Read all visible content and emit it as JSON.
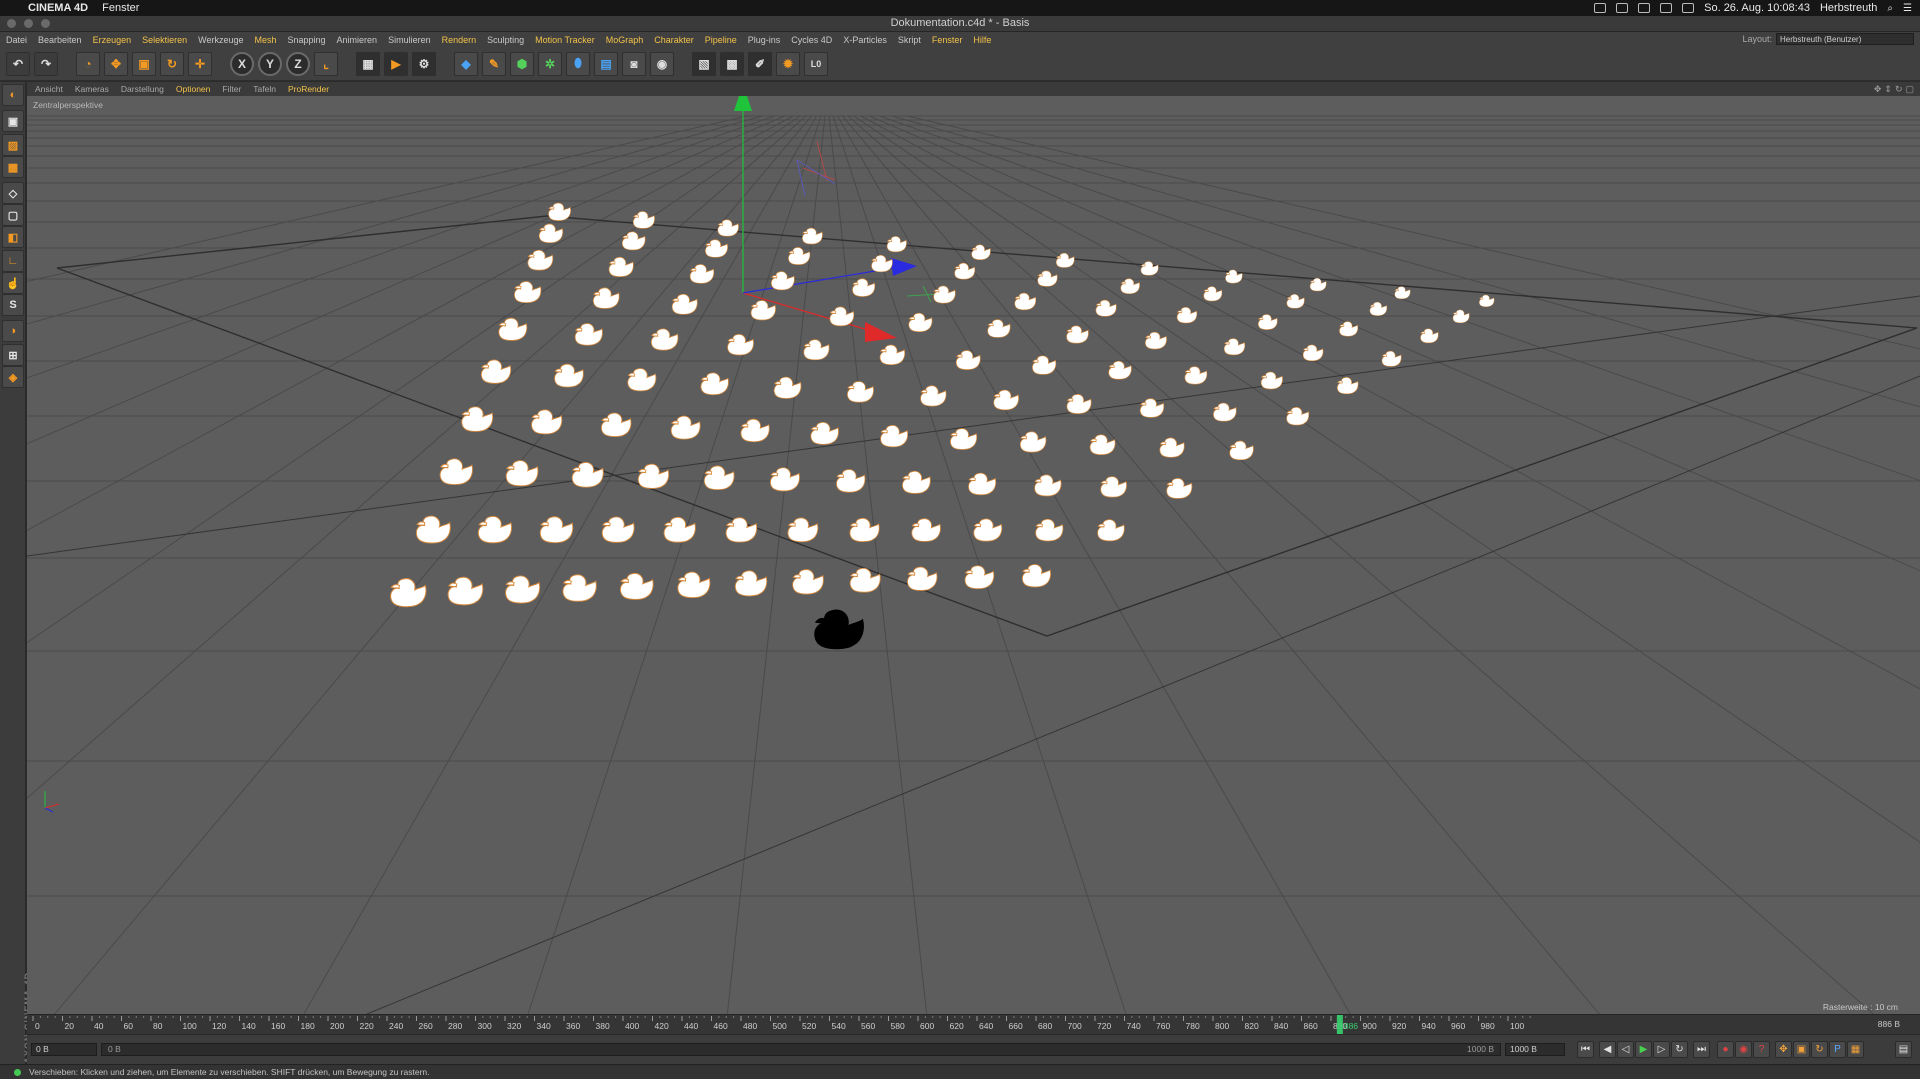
{
  "mac_menubar": {
    "apple_glyph": "",
    "app_name": "CINEMA 4D",
    "menu_item": "Fenster",
    "clock": "So. 26. Aug.  10:08:43",
    "user": "Herbstreuth"
  },
  "window": {
    "title": "Dokumentation.c4d * - Basis"
  },
  "main_menu": {
    "items": [
      {
        "label": "Datei",
        "highlight": false
      },
      {
        "label": "Bearbeiten",
        "highlight": false
      },
      {
        "label": "Erzeugen",
        "highlight": true
      },
      {
        "label": "Selektieren",
        "highlight": true
      },
      {
        "label": "Werkzeuge",
        "highlight": false
      },
      {
        "label": "Mesh",
        "highlight": true
      },
      {
        "label": "Snapping",
        "highlight": false
      },
      {
        "label": "Animieren",
        "highlight": false
      },
      {
        "label": "Simulieren",
        "highlight": false
      },
      {
        "label": "Rendern",
        "highlight": true
      },
      {
        "label": "Sculpting",
        "highlight": false
      },
      {
        "label": "Motion Tracker",
        "highlight": true
      },
      {
        "label": "MoGraph",
        "highlight": true
      },
      {
        "label": "Charakter",
        "highlight": true
      },
      {
        "label": "Pipeline",
        "highlight": true
      },
      {
        "label": "Plug-ins",
        "highlight": false
      },
      {
        "label": "Cycles 4D",
        "highlight": false
      },
      {
        "label": "X-Particles",
        "highlight": false
      },
      {
        "label": "Skript",
        "highlight": false
      },
      {
        "label": "Fenster",
        "highlight": true
      },
      {
        "label": "Hilfe",
        "highlight": true
      }
    ],
    "layout_label": "Layout:",
    "layout_value": "Herbstreuth (Benutzer)"
  },
  "toolbar": {
    "axis_x": "X",
    "axis_y": "Y",
    "axis_z": "Z",
    "layer_label": "L0"
  },
  "left_palette": {
    "snap_glyph": "S",
    "brand_text": "MAXON CINEMA 4D"
  },
  "viewport_menu": {
    "items": [
      {
        "label": "Ansicht",
        "highlight": false
      },
      {
        "label": "Kameras",
        "highlight": false
      },
      {
        "label": "Darstellung",
        "highlight": false
      },
      {
        "label": "Optionen",
        "highlight": true
      },
      {
        "label": "Filter",
        "highlight": false
      },
      {
        "label": "Tafeln",
        "highlight": false
      },
      {
        "label": "ProRender",
        "highlight": true
      }
    ]
  },
  "viewport": {
    "label": "Zentralperspektive",
    "grid_spacing": "Rasterweite : 10 cm",
    "scene": {
      "object": "rubber duck",
      "white_duck_rows": 10,
      "white_duck_cols": 12,
      "black_ducks": 1
    }
  },
  "timeline": {
    "ticks": [
      "0",
      "20",
      "40",
      "60",
      "80",
      "100",
      "120",
      "140",
      "160",
      "180",
      "200",
      "220",
      "240",
      "260",
      "280",
      "300",
      "320",
      "340",
      "360",
      "380",
      "400",
      "420",
      "440",
      "460",
      "480",
      "500",
      "520",
      "540",
      "560",
      "580",
      "600",
      "620",
      "640",
      "660",
      "680",
      "700",
      "720",
      "740",
      "760",
      "780",
      "800",
      "820",
      "840",
      "860",
      "880",
      "900",
      "920",
      "940",
      "960",
      "980",
      "100"
    ],
    "current_frame": "886",
    "end_label": "886 B"
  },
  "playback": {
    "start_field": "0 B",
    "range_start": "0 B",
    "range_end": "1000 B",
    "end_field": "1000 B"
  },
  "status": {
    "message": "Verschieben: Klicken und ziehen, um Elemente zu verschieben. SHIFT drücken, um Bewegung zu rastern."
  },
  "colors": {
    "menu_highlight": "#f3c34a",
    "viewport_bg": "#5d5d5d",
    "axis_x": "#e02a2a",
    "axis_y": "#1fc43b",
    "axis_z": "#2a2ae0",
    "duck_fill": "#ffffff",
    "duck_outline": "#d88a3a",
    "playhead": "#37d06f"
  }
}
